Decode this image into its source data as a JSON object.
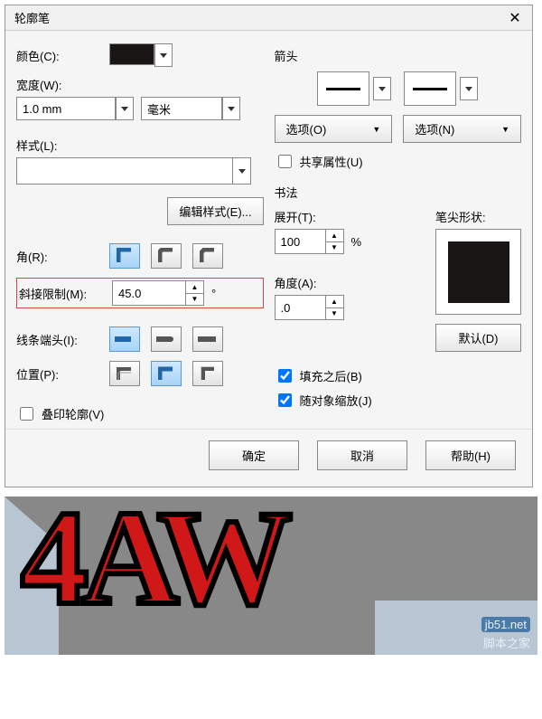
{
  "dialog": {
    "title": "轮廓笔",
    "left": {
      "color_label": "颜色(C):",
      "width_label": "宽度(W):",
      "width_value": "1.0 mm",
      "unit_value": "毫米",
      "style_label": "样式(L):",
      "edit_style_btn": "编辑样式(E)...",
      "corner_label": "角(R):",
      "miter_label": "斜接限制(M):",
      "miter_value": "45.0",
      "miter_unit": "°",
      "cap_label": "线条端头(I):",
      "position_label": "位置(P):",
      "overprint_label": "叠印轮廓(V)"
    },
    "right": {
      "arrow_title": "箭头",
      "options_left": "选项(O)",
      "options_right": "选项(N)",
      "share_attr": "共享属性(U)",
      "calligraphy_title": "书法",
      "stretch_label": "展开(T):",
      "stretch_value": "100",
      "stretch_unit": "%",
      "angle_label": "角度(A):",
      "angle_value": ".0",
      "nib_label": "笔尖形状:",
      "default_btn": "默认(D)",
      "behind_fill": "填充之后(B)",
      "scale_with": "随对象缩放(J)"
    },
    "footer": {
      "ok": "确定",
      "cancel": "取消",
      "help": "帮助(H)"
    }
  },
  "preview": {
    "text": "4AW",
    "watermark_site": "jb51.net",
    "watermark_name": "脚本之家"
  }
}
